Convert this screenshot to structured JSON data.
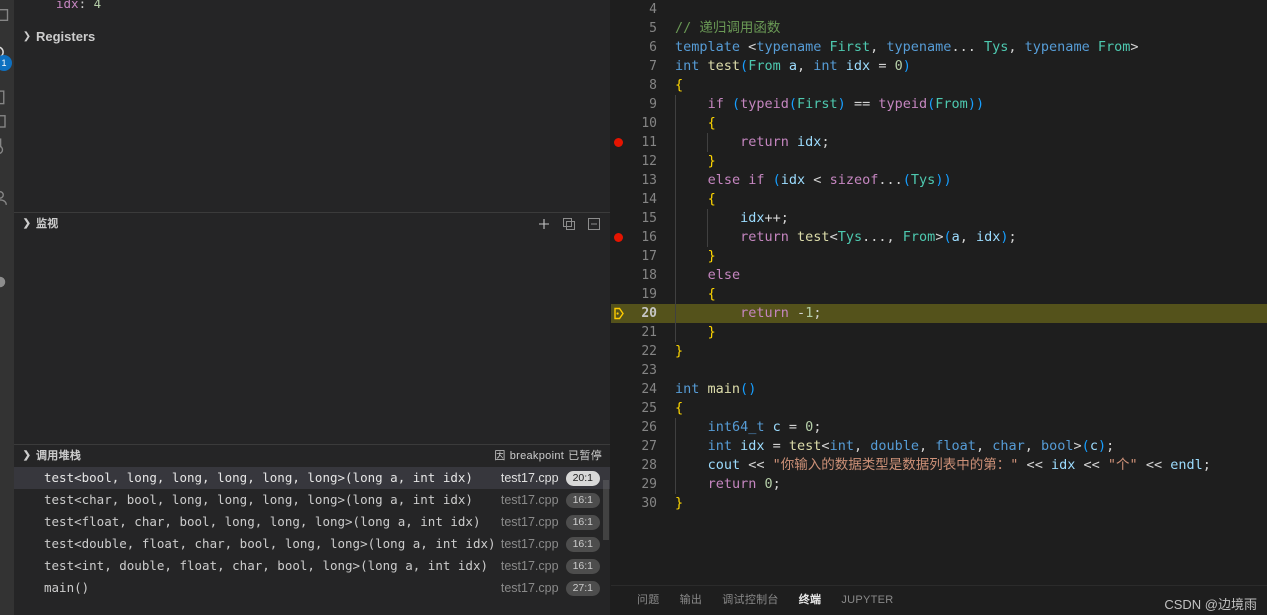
{
  "activity_bar": {
    "badge": "1",
    "icons": [
      "explorer-icon",
      "search-icon",
      "source-control-icon",
      "run-and-debug-icon",
      "extensions-icon",
      "account-icon"
    ]
  },
  "sidebar": {
    "variables": {
      "visible_variable": {
        "name": "idx",
        "separator": ":",
        "value": "4"
      },
      "registers_label": "Registers"
    },
    "watch": {
      "title": "监视",
      "actions": [
        "add-expression-icon",
        "remove-all-expressions-icon",
        "collapse-all-icon"
      ]
    },
    "callstack": {
      "title": "调用堆栈",
      "status": "breakpoint",
      "status_prefix": "因",
      "status_suffix": "已暂停",
      "rows": [
        {
          "name": "test<bool, long, long, long, long, long>(long a, int idx)",
          "file": "test17.cpp",
          "line": "20:1",
          "selected": true
        },
        {
          "name": "test<char, bool, long, long, long, long>(long a, int idx)",
          "file": "test17.cpp",
          "line": "16:1",
          "selected": false
        },
        {
          "name": "test<float, char, bool, long, long, long>(long a, int idx)",
          "file": "test17.cpp",
          "line": "16:1",
          "selected": false
        },
        {
          "name": "test<double, float, char, bool, long, long>(long a, int idx)",
          "file": "test17.cpp",
          "line": "16:1",
          "selected": false
        },
        {
          "name": "test<int, double, float, char, bool, long>(long a, int idx)",
          "file": "test17.cpp",
          "line": "16:1",
          "selected": false
        },
        {
          "name": "main()",
          "file": "test17.cpp",
          "line": "27:1",
          "selected": false
        }
      ]
    }
  },
  "editor": {
    "language": "cpp",
    "current_line": 20,
    "breakpoint_lines": [
      11,
      16
    ],
    "lines": [
      {
        "n": "4",
        "text": ""
      },
      {
        "n": "5",
        "text": "// 递归调用函数"
      },
      {
        "n": "6",
        "text": "template <typename First, typename... Tys, typename From>"
      },
      {
        "n": "7",
        "text": "int test(From a, int idx = 0)"
      },
      {
        "n": "8",
        "text": "{"
      },
      {
        "n": "9",
        "text": "    if (typeid(First) == typeid(From))"
      },
      {
        "n": "10",
        "text": "    {"
      },
      {
        "n": "11",
        "text": "        return idx;"
      },
      {
        "n": "12",
        "text": "    }"
      },
      {
        "n": "13",
        "text": "    else if (idx < sizeof...(Tys))"
      },
      {
        "n": "14",
        "text": "    {"
      },
      {
        "n": "15",
        "text": "        idx++;"
      },
      {
        "n": "16",
        "text": "        return test<Tys..., From>(a, idx);"
      },
      {
        "n": "17",
        "text": "    }"
      },
      {
        "n": "18",
        "text": "    else"
      },
      {
        "n": "19",
        "text": "    {"
      },
      {
        "n": "20",
        "text": "        return -1;"
      },
      {
        "n": "21",
        "text": "    }"
      },
      {
        "n": "22",
        "text": "}"
      },
      {
        "n": "23",
        "text": ""
      },
      {
        "n": "24",
        "text": "int main()"
      },
      {
        "n": "25",
        "text": "{"
      },
      {
        "n": "26",
        "text": "    int64_t c = 0;"
      },
      {
        "n": "27",
        "text": "    int idx = test<int, double, float, char, bool>(c);"
      },
      {
        "n": "28",
        "text": "    cout << \"你输入的数据类型是数据列表中的第：\" << idx << \"个\" << endl;"
      },
      {
        "n": "29",
        "text": "    return 0;"
      },
      {
        "n": "30",
        "text": "}"
      }
    ]
  },
  "panel": {
    "tabs": [
      {
        "label": "问题",
        "active": false
      },
      {
        "label": "输出",
        "active": false
      },
      {
        "label": "调试控制台",
        "active": false
      },
      {
        "label": "终端",
        "active": true
      },
      {
        "label": "JUPYTER",
        "active": false
      }
    ]
  },
  "watermark": "CSDN @边境雨",
  "colors": {
    "editor_background": "#1e1e1e",
    "sidebar_background": "#252526",
    "activity_background": "#333333",
    "breakpoint": "#e51400",
    "current_line_highlight": "#54521b",
    "badge": "#0e70c0",
    "selection": "#37373d"
  }
}
